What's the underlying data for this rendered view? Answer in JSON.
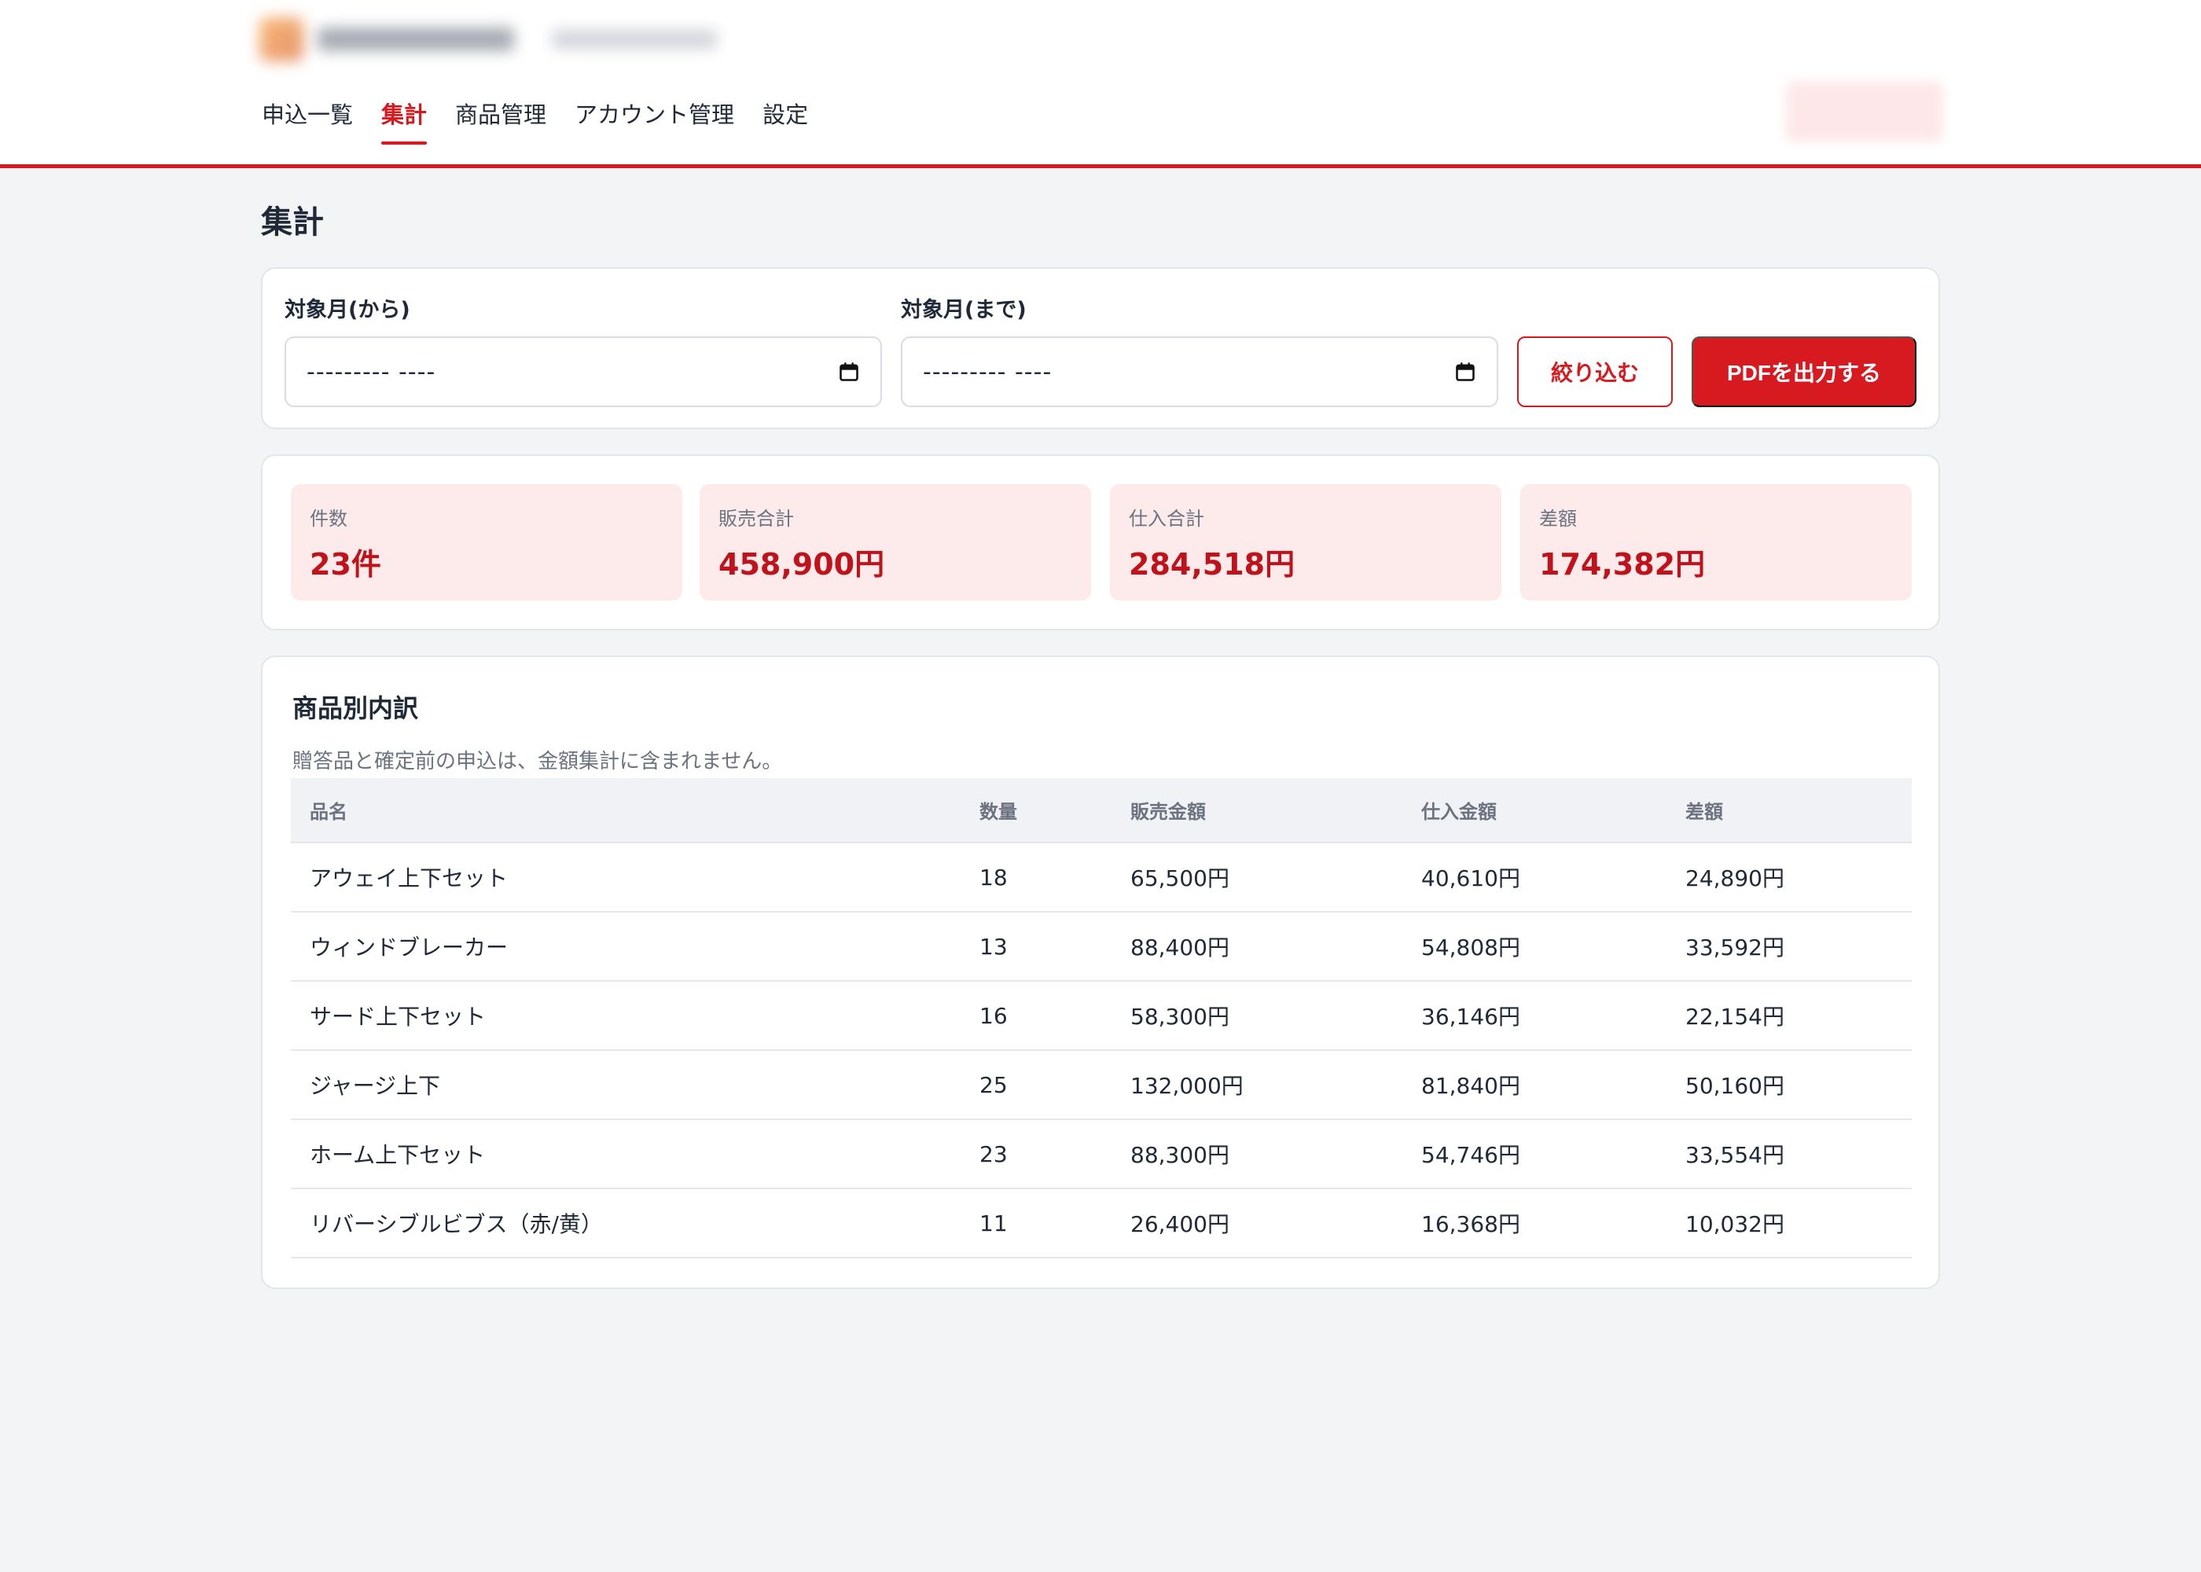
{
  "nav": {
    "items": [
      {
        "label": "申込一覧",
        "active": false
      },
      {
        "label": "集計",
        "active": true
      },
      {
        "label": "商品管理",
        "active": false
      },
      {
        "label": "アカウント管理",
        "active": false
      },
      {
        "label": "設定",
        "active": false
      }
    ]
  },
  "page": {
    "title": "集計"
  },
  "filter": {
    "from_label": "対象月(から)",
    "to_label": "対象月(まで)",
    "from_value": "--------- ----",
    "to_value": "--------- ----",
    "filter_button": "絞り込む",
    "pdf_button": "PDFを出力する"
  },
  "stats": [
    {
      "label": "件数",
      "value": "23件"
    },
    {
      "label": "販売合計",
      "value": "458,900円"
    },
    {
      "label": "仕入合計",
      "value": "284,518円"
    },
    {
      "label": "差額",
      "value": "174,382円"
    }
  ],
  "breakdown": {
    "title": "商品別内訳",
    "note": "贈答品と確定前の申込は、金額集計に含まれません。",
    "columns": [
      "品名",
      "数量",
      "販売金額",
      "仕入金額",
      "差額"
    ],
    "rows": [
      [
        "アウェイ上下セット",
        "18",
        "65,500円",
        "40,610円",
        "24,890円"
      ],
      [
        "ウィンドブレーカー",
        "13",
        "88,400円",
        "54,808円",
        "33,592円"
      ],
      [
        "サード上下セット",
        "16",
        "58,300円",
        "36,146円",
        "22,154円"
      ],
      [
        "ジャージ上下",
        "25",
        "132,000円",
        "81,840円",
        "50,160円"
      ],
      [
        "ホーム上下セット",
        "23",
        "88,300円",
        "54,746円",
        "33,554円"
      ],
      [
        "リバーシブルビブス（赤/黄）",
        "11",
        "26,400円",
        "16,368円",
        "10,032円"
      ]
    ]
  },
  "colors": {
    "accent": "#d71920",
    "stat_bg": "#fdeaea",
    "stat_value": "#c0121a",
    "page_bg": "#f3f4f6"
  },
  "icons": {
    "brand": "app-logo-icon",
    "calendar": "calendar-icon"
  }
}
